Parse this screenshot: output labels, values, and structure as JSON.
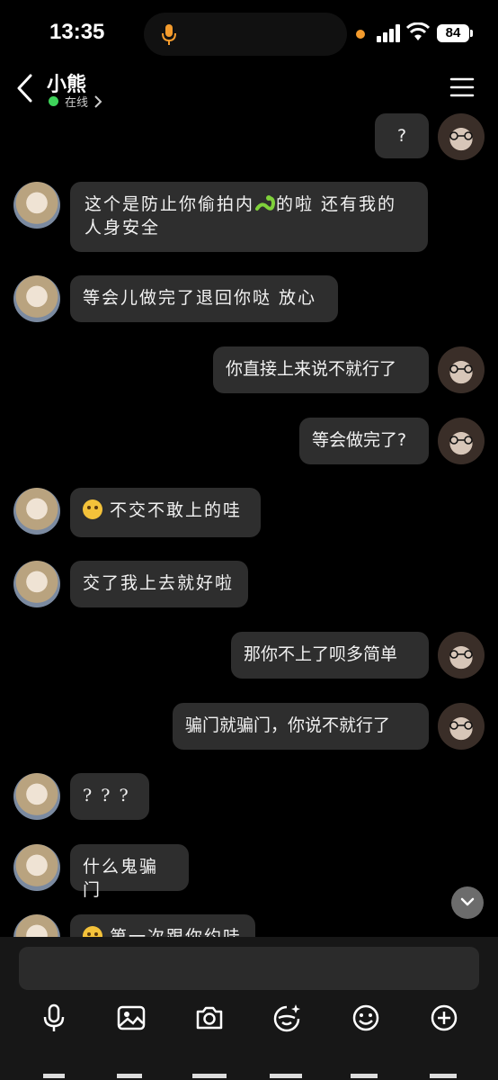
{
  "status_bar": {
    "time": "13:35",
    "battery": "84"
  },
  "header": {
    "name": "小熊",
    "status": "在线"
  },
  "messages": [
    {
      "side": "right",
      "text": "?"
    },
    {
      "side": "left",
      "text_a": "这个是防止你偷拍内",
      "text_b": "的啦 还有我的人身安全"
    },
    {
      "side": "left",
      "text": "等会儿做完了退回你哒 放心"
    },
    {
      "side": "right",
      "text": "你直接上来说不就行了"
    },
    {
      "side": "right",
      "text": "等会做完了?"
    },
    {
      "side": "left",
      "text": "不交不敢上的哇"
    },
    {
      "side": "left",
      "text": "交了我上去就好啦"
    },
    {
      "side": "right",
      "text": "那你不上了呗多简单"
    },
    {
      "side": "right",
      "text": "骗门就骗门，你说不就行了"
    },
    {
      "side": "left",
      "text": "? ? ?"
    },
    {
      "side": "left",
      "text": "什么鬼骗门"
    },
    {
      "side": "left",
      "text": "第一次跟你约哇"
    }
  ],
  "icons": [
    "mic-icon",
    "image-icon",
    "camera-icon",
    "sticker-icon",
    "emoji-icon",
    "plus-icon"
  ],
  "colors": {
    "bubble": "#2e2e2e",
    "online": "#3ed35a",
    "input_bar": "#171717"
  }
}
